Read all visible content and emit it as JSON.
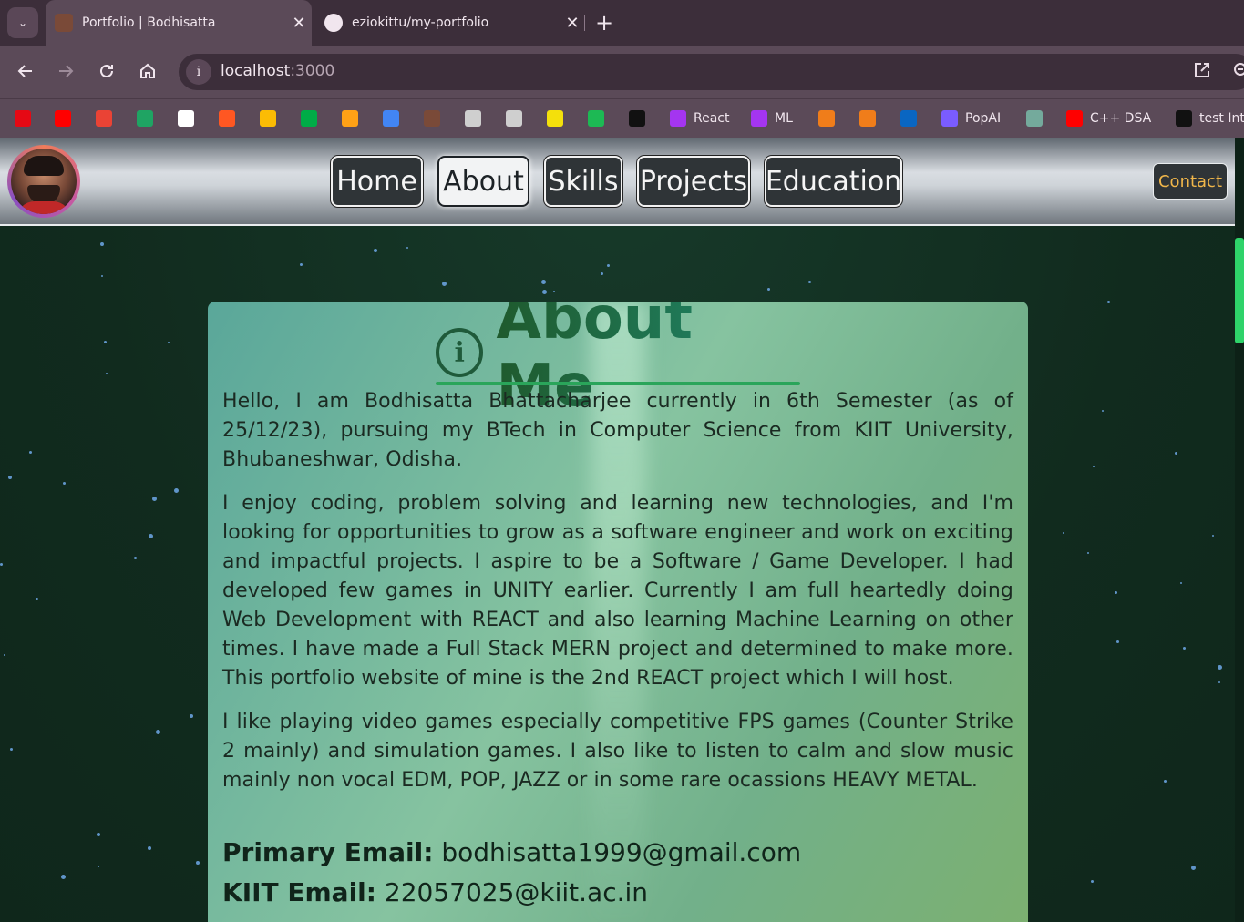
{
  "browser": {
    "tabs": [
      {
        "title": "Portfolio | Bodhisatta",
        "close": "✕",
        "active": true
      },
      {
        "title": "eziokittu/my-portfolio",
        "close": "✕",
        "active": false
      }
    ],
    "new_tab": "+",
    "tab_list": "⌄",
    "url_host": "localhost",
    "url_port": ":3000",
    "bookmarks": [
      {
        "label": "",
        "icon": "netflix-icon",
        "color": "#e50914"
      },
      {
        "label": "",
        "icon": "youtube-icon",
        "color": "#ff0000"
      },
      {
        "label": "",
        "icon": "gmail-icon",
        "color": "#ea4335"
      },
      {
        "label": "",
        "icon": "drive-icon",
        "color": "#1fa463"
      },
      {
        "label": "",
        "icon": "github-icon",
        "color": "#ffffff"
      },
      {
        "label": "",
        "icon": "x-icon",
        "color": "#ff5722"
      },
      {
        "label": "",
        "icon": "classroom-icon",
        "color": "#fbbc04"
      },
      {
        "label": "",
        "icon": "meet-icon",
        "color": "#00ac47"
      },
      {
        "label": "",
        "icon": "leetcode-icon",
        "color": "#ffa116"
      },
      {
        "label": "",
        "icon": "analytics-icon",
        "color": "#4285f4"
      },
      {
        "label": "",
        "icon": "profile-icon",
        "color": "#7a4a38"
      },
      {
        "label": "",
        "icon": "unity-icon",
        "color": "#cfcfcf"
      },
      {
        "label": "",
        "icon": "unity-icon",
        "color": "#cfcfcf"
      },
      {
        "label": "",
        "icon": "wavy-icon",
        "color": "#f4e00b"
      },
      {
        "label": "",
        "icon": "spotify-icon",
        "color": "#1db954"
      },
      {
        "label": "",
        "icon": "hackerrank-icon",
        "color": "#111111"
      },
      {
        "label": "React",
        "icon": "udemy-icon",
        "color": "#a435f0"
      },
      {
        "label": "ML",
        "icon": "udemy-icon",
        "color": "#a435f0"
      },
      {
        "label": "",
        "icon": "codingninjas-icon",
        "color": "#f07d1a"
      },
      {
        "label": "",
        "icon": "codingninjas-icon",
        "color": "#f07d1a"
      },
      {
        "label": "",
        "icon": "linkedin-icon",
        "color": "#0a66c2"
      },
      {
        "label": "PopAI",
        "icon": "popai-icon",
        "color": "#7a5cff"
      },
      {
        "label": "",
        "icon": "chatgpt-icon",
        "color": "#74aa9c"
      },
      {
        "label": "C++  DSA",
        "icon": "youtube-icon",
        "color": "#ff0000"
      },
      {
        "label": "test Inte",
        "icon": "hackerrank-icon",
        "color": "#111111"
      }
    ]
  },
  "site": {
    "nav": [
      {
        "label": "Home",
        "active": false
      },
      {
        "label": "About",
        "active": true
      },
      {
        "label": "Skills",
        "active": false
      },
      {
        "label": "Projects",
        "active": false
      },
      {
        "label": "Education",
        "active": false
      }
    ],
    "contact": "Contact",
    "about": {
      "heading": "About Me",
      "icon": "info-icon",
      "paragraphs": [
        "Hello, I am Bodhisatta Bhattacharjee currently in 6th Semester (as of 25/12/23), pursuing my BTech in Computer Science from KIIT University, Bhubaneshwar, Odisha.",
        "I enjoy coding, problem solving and learning new technologies, and I'm looking for opportunities to grow as a software engineer and work on exciting and impactful projects. I aspire to be a Software / Game Developer. I had developed few games in UNITY earlier. Currently I am full heartedly doing Web Development with REACT and also learning Machine Learning on other times. I have made a Full Stack MERN project and determined to make more. This portfolio website of mine is the 2nd REACT project which I will host.",
        "I like playing video games especially competitive FPS games (Counter Strike 2 mainly) and simulation games. I also like to listen to calm and slow music mainly non vocal EDM, POP, JAZZ or in some rare ocassions HEAVY METAL."
      ],
      "primary_email_label": "Primary Email:",
      "primary_email": "bodhisatta1999@gmail.com",
      "kiit_email_label": "KIIT Email:",
      "kiit_email": "22057025@kiit.ac.in"
    }
  },
  "colors": {
    "accent_contact": "#f0b64a",
    "page_bg": "#112b1e",
    "card_green": "#86c3a0",
    "scroll_thumb": "#2fd36a"
  }
}
